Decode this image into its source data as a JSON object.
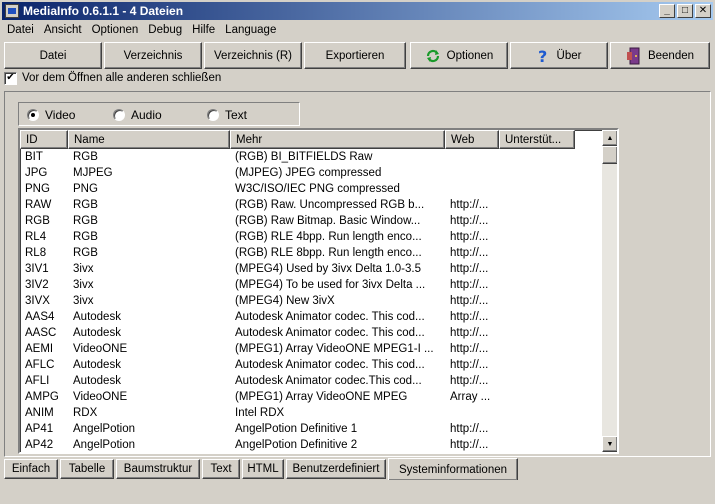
{
  "window": {
    "title": "MediaInfo 0.6.1.1 - 4 Dateien",
    "minimize_glyph": "_",
    "maximize_glyph": "□",
    "close_glyph": "✕"
  },
  "menu": [
    "Datei",
    "Ansicht",
    "Optionen",
    "Debug",
    "Hilfe",
    "Language"
  ],
  "toolbar": {
    "datei": "Datei",
    "verzeichnis": "Verzeichnis",
    "verzeichnis_r": "Verzeichnis (R)",
    "exportieren": "Exportieren",
    "optionen": "Optionen",
    "ueber": "Über",
    "beenden": "Beenden"
  },
  "checkbox": {
    "label": "Vor dem Öffnen alle anderen schließen",
    "checked": true,
    "glyph": "✔"
  },
  "filter": {
    "video": "Video",
    "audio": "Audio",
    "text": "Text",
    "selected": "Video"
  },
  "columns": [
    "ID",
    "Name",
    "Mehr",
    "Web",
    "Unterstüt..."
  ],
  "rows": [
    [
      "BIT",
      "RGB",
      "(RGB) BI_BITFIELDS Raw",
      "",
      ""
    ],
    [
      "JPG",
      "MJPEG",
      "(MJPEG) JPEG compressed",
      "",
      ""
    ],
    [
      "PNG",
      "PNG",
      "W3C/ISO/IEC PNG compressed",
      "",
      ""
    ],
    [
      "RAW",
      "RGB",
      "(RGB) Raw. Uncompressed RGB b...",
      "http://...",
      ""
    ],
    [
      "RGB",
      "RGB",
      "(RGB) Raw Bitmap. Basic Window...",
      "http://...",
      ""
    ],
    [
      "RL4",
      "RGB",
      "(RGB) RLE 4bpp. Run length enco...",
      "http://...",
      ""
    ],
    [
      "RL8",
      "RGB",
      "(RGB) RLE 8bpp. Run length enco...",
      "http://...",
      ""
    ],
    [
      "3IV1",
      "3ivx",
      "(MPEG4) Used by 3ivx Delta 1.0-3.5",
      "http://...",
      ""
    ],
    [
      "3IV2",
      "3ivx",
      "(MPEG4) To be used for 3ivx Delta ...",
      "http://...",
      ""
    ],
    [
      "3IVX",
      "3ivx",
      "(MPEG4) New 3ivX",
      "http://...",
      ""
    ],
    [
      "AAS4",
      "Autodesk",
      "Autodesk Animator codec. This cod...",
      "http://...",
      ""
    ],
    [
      "AASC",
      "Autodesk",
      "Autodesk Animator codec. This cod...",
      "http://...",
      ""
    ],
    [
      "AEMI",
      "VideoONE",
      "(MPEG1) Array VideoONE MPEG1-I ...",
      "http://...",
      ""
    ],
    [
      "AFLC",
      "Autodesk",
      "Autodesk Animator codec. This cod...",
      "http://...",
      ""
    ],
    [
      "AFLI",
      "Autodesk",
      "Autodesk Animator codec.This cod...",
      "http://...",
      ""
    ],
    [
      "AMPG",
      "VideoONE",
      "(MPEG1) Array VideoONE MPEG",
      "Array ...",
      ""
    ],
    [
      "ANIM",
      "RDX",
      "Intel RDX",
      "",
      ""
    ],
    [
      "AP41",
      "AngelPotion",
      "AngelPotion Definitive 1",
      "http://...",
      ""
    ],
    [
      "AP42",
      "AngelPotion",
      "AngelPotion Definitive 2",
      "http://...",
      ""
    ]
  ],
  "scroll_up_glyph": "▲",
  "scroll_down_glyph": "▼",
  "tabs": [
    "Einfach",
    "Tabelle",
    "Baumstruktur",
    "Text",
    "HTML",
    "Benutzerdefiniert",
    "Systeminformationen"
  ],
  "active_tab": "Systeminformationen",
  "icons": {
    "optionen": "refresh-arrows-icon",
    "ueber": "question-mark-icon",
    "beenden": "exit-door-icon"
  }
}
